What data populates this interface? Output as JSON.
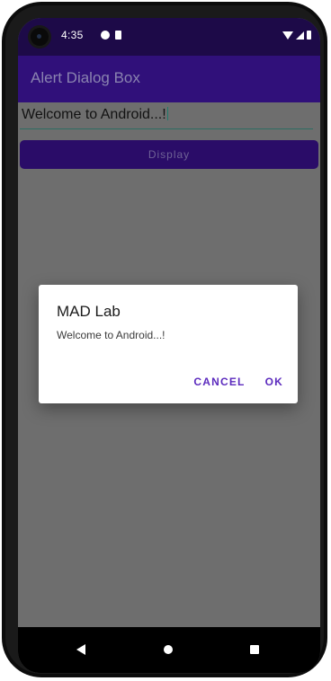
{
  "status_bar": {
    "time": "4:35"
  },
  "app_bar": {
    "title": "Alert Dialog Box"
  },
  "main": {
    "input_value": "Welcome to Android...!",
    "display_button_label": "Display"
  },
  "dialog": {
    "title": "MAD Lab",
    "message": "Welcome to Android...!",
    "cancel_label": "CANCEL",
    "ok_label": "OK"
  },
  "colors": {
    "status_bar": "#1d0a48",
    "app_bar": "#30107a",
    "button": "#2a0c68",
    "dialog_accent": "#5c2bbe",
    "scrim": "#6e6e6e"
  },
  "icons": {
    "status": [
      "notification-icon",
      "sim-card-icon",
      "wifi-icon",
      "signal-icon",
      "battery-icon"
    ],
    "nav": [
      "back-icon",
      "home-icon",
      "recents-icon"
    ]
  }
}
